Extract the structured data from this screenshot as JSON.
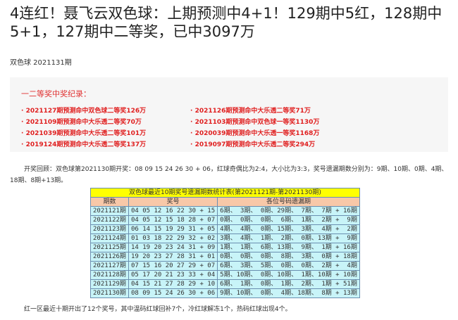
{
  "title": "4连红！聂飞云双色球：上期预测中4+1！129期中5红，128期中5+1，127期中二等奖，已中3097万",
  "subtitle": "双色球 2021131期",
  "records": {
    "heading": "一二等奖中奖纪录：",
    "items": [
      "2021127期预测命中双色球二等奖126万",
      "2021126期预测命中大乐透二等奖71万",
      "2021109期预测命中大乐透二等奖70万",
      "2021103期预测命中双色球一等奖1130万",
      "2021039期预测命中大乐透二等奖101万",
      "2020039期预测命中大乐透一等奖1168万",
      "2019124期预测命中大乐透二等奖137万",
      "2019097期预测命中大乐透二等奖294万"
    ]
  },
  "review": "开奖回顾：双色球第2021130期开奖：08 09 15 24 26 30 + 06，红球奇偶比为2:4，大小比为3:3，奖号遗漏期数分别为：9期、10期、0期、4期、18期、8期+13期。",
  "table": {
    "caption": "双色球最近10期奖号遗漏期数统计表(第2021121期-第2021130期)",
    "headers": [
      "期数",
      "奖号",
      "各位号码遗漏期"
    ],
    "rows": [
      [
        "2021121期",
        "04 05 12 16 22 30 + 15",
        "6期、 3期、 0期、29期、 7期、 7期 + 16期"
      ],
      [
        "2021122期",
        "04 05 12 15 18 28 + 07",
        "0期、 0期、 0期、 6期、 1期、 2期 +  9期"
      ],
      [
        "2021123期",
        "06 14 15 19 29 31 + 05",
        "4期、 4期、 0期、15期、 3期、 4期 +  2期"
      ],
      [
        "2021124期",
        "01 03 18 22 29 32 + 02",
        "3期、 4期、 1期、 2期、 0期、13期 +  9期"
      ],
      [
        "2021125期",
        "14 19 20 23 24 31 + 09",
        "1期、 1期、 6期、13期、 9期、 1期 + 16期"
      ],
      [
        "2021126期",
        "19 20 23 27 28 31 + 01",
        "0期、 0期、 0期、 8期、 3期、 0期 + 18期"
      ],
      [
        "2021127期",
        "07 15 16 20 27 29 + 07",
        "6期、 3期、 5期、 0期、 0期、 2期 +  4期"
      ],
      [
        "2021128期",
        "05 17 20 21 23 33 + 04",
        "5期、10期、 0期、10期、 1期、10期 + 10期"
      ],
      [
        "2021129期",
        "04 15 21 27 28 29 + 10",
        "6期、 1期、 0期、 1期、 2期、 1期 + 51期"
      ],
      [
        "2021130期",
        "08 09 15 24 26 30 + 06",
        "9期、10期、 0期、 4期、18期、 8期 + 13期"
      ]
    ]
  },
  "summary": "红一区最近十期开出了12个奖号，其中温码红球回补7个，冷红球解冻1个，热码红球出现4个。"
}
